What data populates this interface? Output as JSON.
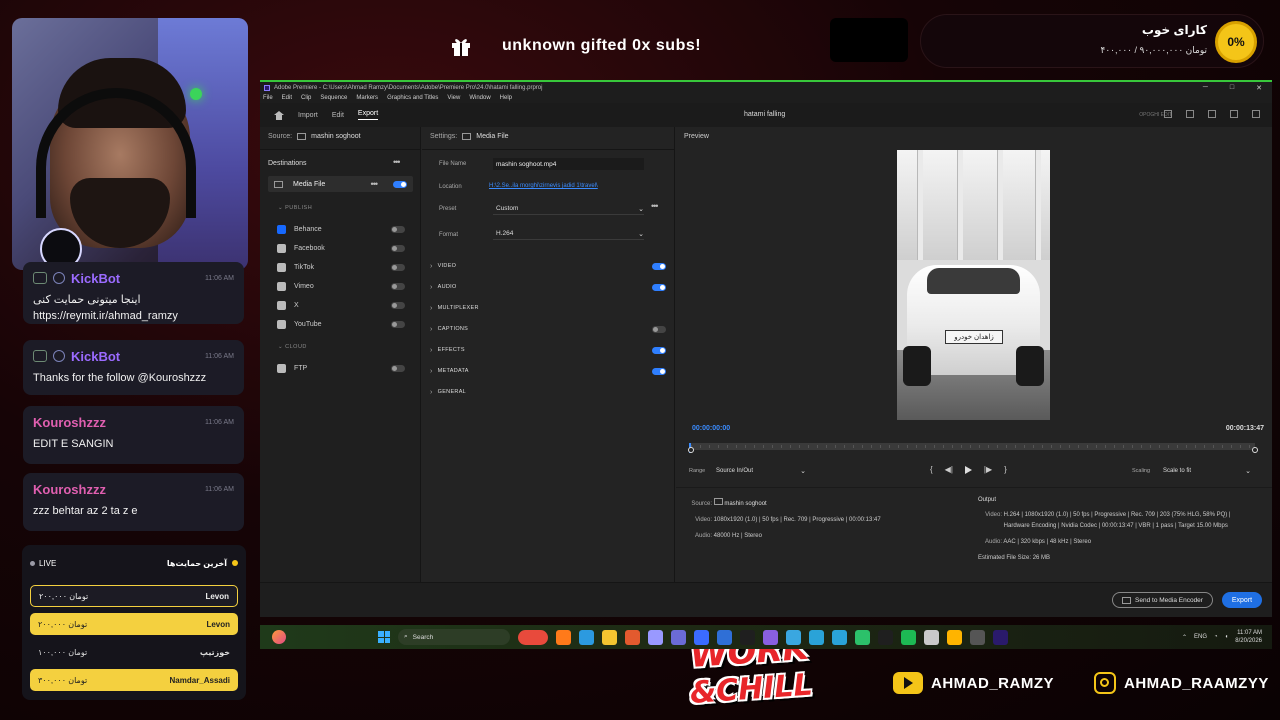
{
  "overlay": {
    "gift_text": "unknown gifted 0x subs!",
    "goal": {
      "percent": "0%",
      "title": "کارای خوب",
      "amount": "۴۰۰,۰۰۰ / ۹۰,۰۰۰,۰۰۰ تومان"
    },
    "chat": [
      {
        "user": "KickBot",
        "color": "#9b6bff",
        "time": "11:06 AM",
        "message": "اینجا میتونی حمایت کنی https://reymit.ir/ahmad_ramzy",
        "bot": true
      },
      {
        "user": "KickBot",
        "color": "#9b6bff",
        "time": "11:06 AM",
        "message": "Thanks for the follow @Kouroshzzz",
        "bot": true
      },
      {
        "user": "Kouroshzzz",
        "color": "#e05fb0",
        "time": "11:06 AM",
        "message": "EDIT E SANGIN",
        "bot": false
      },
      {
        "user": "Kouroshzzz",
        "color": "#e05fb0",
        "time": "11:06 AM",
        "message": "zzz behtar az 2 ta z e",
        "bot": false
      }
    ],
    "donations": {
      "live_label": "LIVE",
      "title": "آخرین حمایت‌ها",
      "rows": [
        {
          "amount": "۲۰۰,۰۰۰ تومان",
          "name": "Levon",
          "style": "dark"
        },
        {
          "amount": "۲۰۰,۰۰۰ تومان",
          "name": "Levon",
          "style": "yellow"
        },
        {
          "amount": "۱۰۰,۰۰۰ تومان",
          "name": "خوزتیپ",
          "style": "plain"
        },
        {
          "amount": "۳۰۰,۰۰۰ تومان",
          "name": "Namdar_Assadi",
          "style": "yellow"
        }
      ]
    },
    "youtube": "AHMAD_RAMZY",
    "instagram": "AHMAD_RAAMZYY",
    "logo_line1": "WORK",
    "logo_line2": "&CHILL"
  },
  "premiere": {
    "title": "Adobe Premiere - C:\\Users\\Ahmad Ramzy\\Documents\\Adobe\\Premiere Pro\\24.0\\hatami falling.prproj",
    "menu": [
      "File",
      "Edit",
      "Clip",
      "Sequence",
      "Markers",
      "Graphics and Titles",
      "View",
      "Window",
      "Help"
    ],
    "tabs": [
      "Import",
      "Edit",
      "Export"
    ],
    "active_tab": "Export",
    "project_name": "hatami falling",
    "workspace_label": "OPOGHI EDIT",
    "source": {
      "label": "Source:",
      "value": "mashin soghoot"
    },
    "destinations": {
      "title": "Destinations",
      "media_file": "Media File",
      "publish_label": "PUBLISH",
      "publish": [
        {
          "name": "Behance",
          "color": "#1769ff"
        },
        {
          "name": "Facebook",
          "color": "#bbbbbb"
        },
        {
          "name": "TikTok",
          "color": "#bbbbbb"
        },
        {
          "name": "Vimeo",
          "color": "#bbbbbb"
        },
        {
          "name": "X",
          "color": "#bbbbbb"
        },
        {
          "name": "YouTube",
          "color": "#bbbbbb"
        }
      ],
      "cloud_label": "CLOUD",
      "cloud": [
        {
          "name": "FTP",
          "color": "#bbbbbb"
        }
      ]
    },
    "settings": {
      "label": "Settings:",
      "value": "Media File",
      "file_name_label": "File Name",
      "file_name": "mashin soghoot.mp4",
      "location_label": "Location",
      "location": "H:\\2.Se..ila morghi\\zirnevis jadid 1\\travel\\",
      "preset_label": "Preset",
      "preset": "Custom",
      "format_label": "Format",
      "format": "H.264",
      "sections": [
        {
          "name": "VIDEO",
          "toggle": "on"
        },
        {
          "name": "AUDIO",
          "toggle": "on"
        },
        {
          "name": "MULTIPLEXER",
          "toggle": "none"
        },
        {
          "name": "CAPTIONS",
          "toggle": "off"
        },
        {
          "name": "EFFECTS",
          "toggle": "on"
        },
        {
          "name": "METADATA",
          "toggle": "on"
        },
        {
          "name": "GENERAL",
          "toggle": "none"
        }
      ]
    },
    "preview": {
      "title": "Preview",
      "plate": "زاهدان خودرو",
      "timecode_start": "00:00:00:00",
      "timecode_end": "00:00:13:47",
      "range_label": "Range",
      "range_value": "Source In/Out",
      "scaling_label": "Scaling",
      "scaling_value": "Scale to fit"
    },
    "summary": {
      "source_label": "Source:",
      "source_value": "mashin soghoot",
      "video_label": "Video:",
      "video_value": "1080x1920 (1.0)  |  50 fps  |  Rec. 709  |  Progressive  |  00:00:13:47",
      "audio_label": "Audio:",
      "audio_value": "48000 Hz  |  Stereo",
      "output_label": "Output",
      "out_video_label": "Video:",
      "out_video_1": "H.264  |  1080x1920 (1.0)  |  50 fps  |  Progressive  |  Rec. 709  |  203 (75% HLG, 58% PQ)  |",
      "out_video_2": "Hardware Encoding  |  Nvidia Codec  |  00:00:13:47  |  VBR  |  1 pass  |  Target 15.00 Mbps",
      "out_audio_label": "Audio:",
      "out_audio": "AAC  |  320 kbps  |  48 kHz  |  Stereo",
      "size_label": "Estimated File Size:",
      "size_value": "26 MB"
    },
    "send_encoder": "Send to Media Encoder",
    "export_button": "Export"
  },
  "taskbar": {
    "search_placeholder": "Search",
    "lang": "ENG",
    "time": "11:07 AM",
    "date": "8/20/2026",
    "apps": [
      "#e84a3c",
      "#ff7a1a",
      "#2c9ae0",
      "#f4c430",
      "#e35a2e",
      "#9999ff",
      "#6b6bd6",
      "#3b6bff",
      "#2f6fd6",
      "#1f1f1f",
      "#8a5fe0",
      "#3aa7e0",
      "#2aa3d8",
      "#2aa3d8",
      "#2cc16a",
      "#1f1f1f",
      "#1db954",
      "#c9c9c9",
      "#ffb400",
      "#555555",
      "#2a1a6b"
    ]
  }
}
